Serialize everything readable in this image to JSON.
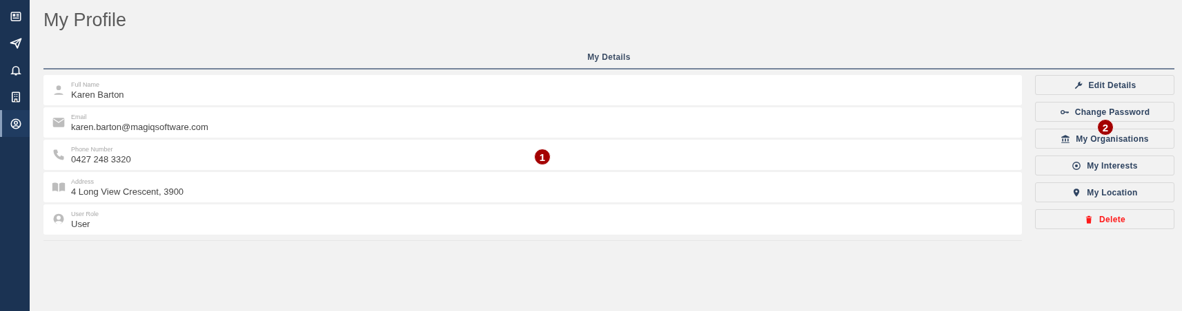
{
  "sidebar": {
    "items": [
      {
        "selected": false
      },
      {
        "selected": false
      },
      {
        "selected": false
      },
      {
        "selected": false
      },
      {
        "selected": true
      }
    ]
  },
  "page": {
    "title": "My Profile"
  },
  "tabs": [
    {
      "label": "My Details",
      "selected": true
    }
  ],
  "details": [
    {
      "label": "Full Name",
      "value": "Karen Barton"
    },
    {
      "label": "Email",
      "value": "karen.barton@magiqsoftware.com"
    },
    {
      "label": "Phone Number",
      "value": "0427 248 3320"
    },
    {
      "label": "Address",
      "value": "4 Long View Crescent, 3900"
    },
    {
      "label": "User Role",
      "value": "User"
    }
  ],
  "actions": [
    {
      "label": "Edit Details",
      "kind": "normal"
    },
    {
      "label": "Change Password",
      "kind": "normal"
    },
    {
      "label": "My Organisations",
      "kind": "normal"
    },
    {
      "label": "My Interests",
      "kind": "normal"
    },
    {
      "label": "My Location",
      "kind": "normal"
    },
    {
      "label": "Delete",
      "kind": "danger"
    }
  ],
  "markers": [
    {
      "label": "1"
    },
    {
      "label": "2"
    }
  ]
}
